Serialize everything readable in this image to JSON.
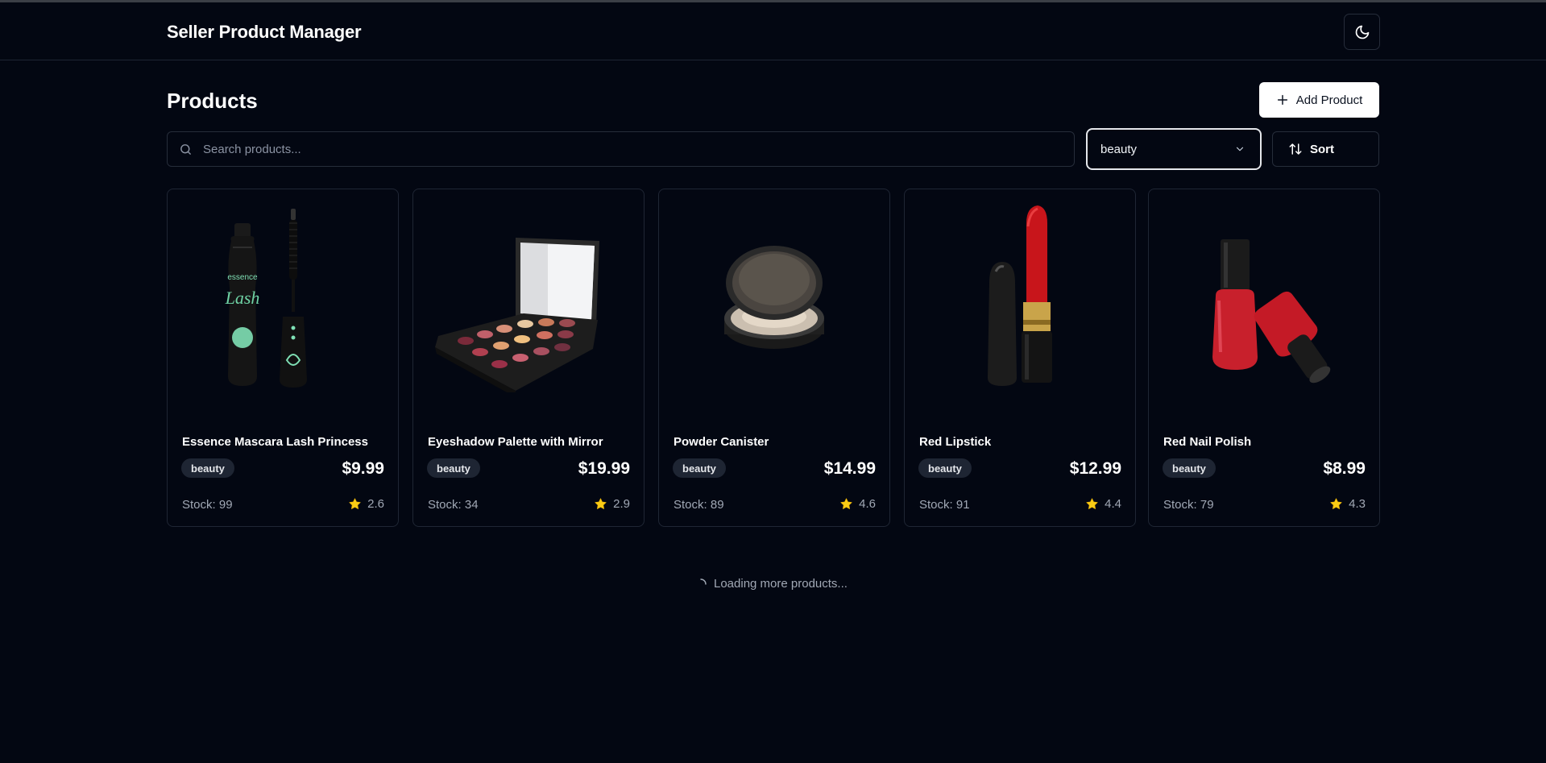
{
  "header": {
    "title": "Seller Product Manager",
    "theme_icon": "moon-icon"
  },
  "main": {
    "title": "Products",
    "add_button_label": "Add Product",
    "search": {
      "placeholder": "Search products...",
      "value": ""
    },
    "category_filter": {
      "selected": "beauty"
    },
    "sort_label": "Sort",
    "loading_text": "Loading more products..."
  },
  "products": [
    {
      "name": "Essence Mascara Lash Princess",
      "category": "beauty",
      "price": "$9.99",
      "stock": "Stock: 99",
      "rating": "2.6",
      "image": "mascara"
    },
    {
      "name": "Eyeshadow Palette with Mirror",
      "category": "beauty",
      "price": "$19.99",
      "stock": "Stock: 34",
      "rating": "2.9",
      "image": "eyeshadow-palette"
    },
    {
      "name": "Powder Canister",
      "category": "beauty",
      "price": "$14.99",
      "stock": "Stock: 89",
      "rating": "4.6",
      "image": "powder-canister"
    },
    {
      "name": "Red Lipstick",
      "category": "beauty",
      "price": "$12.99",
      "stock": "Stock: 91",
      "rating": "4.4",
      "image": "lipstick"
    },
    {
      "name": "Red Nail Polish",
      "category": "beauty",
      "price": "$8.99",
      "stock": "Stock: 79",
      "rating": "4.3",
      "image": "nail-polish"
    }
  ],
  "colors": {
    "background": "#030712",
    "border": "#1f2634",
    "badge": "#1e2533",
    "star": "#facc15",
    "muted_text": "#a1a8b5"
  }
}
